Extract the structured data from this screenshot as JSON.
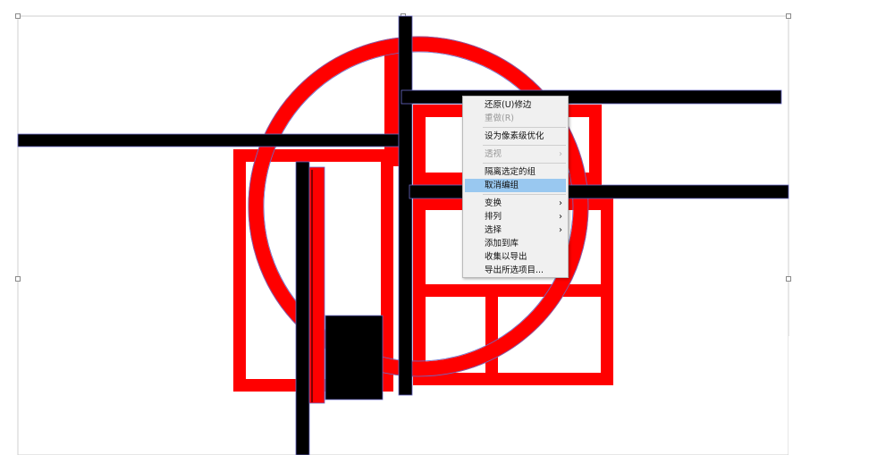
{
  "context_menu": {
    "items": [
      {
        "label": "还原(U)修边",
        "disabled": false
      },
      {
        "label": "重做(R)",
        "disabled": true
      },
      {
        "separator": true
      },
      {
        "label": "设为像素级优化",
        "disabled": false
      },
      {
        "separator": true
      },
      {
        "label": "透视",
        "disabled": true,
        "submenu": true
      },
      {
        "separator": true
      },
      {
        "label": "隔离选定的组",
        "disabled": false
      },
      {
        "label": "取消编组",
        "disabled": false,
        "active": true
      },
      {
        "separator": true
      },
      {
        "label": "变换",
        "disabled": false,
        "submenu": true
      },
      {
        "label": "排列",
        "disabled": false,
        "submenu": true
      },
      {
        "label": "选择",
        "disabled": false,
        "submenu": true
      },
      {
        "label": "添加到库",
        "disabled": false
      },
      {
        "label": "收集以导出",
        "disabled": false
      },
      {
        "label": "导出所选项目...",
        "disabled": false
      }
    ]
  },
  "colors": {
    "artwork_red": "#ff0000",
    "artwork_black": "#000000",
    "selection": "#6b6bc8",
    "menu_highlight": "#99c8f0"
  },
  "icons": {
    "submenu_arrow": "chevron-right-icon"
  }
}
